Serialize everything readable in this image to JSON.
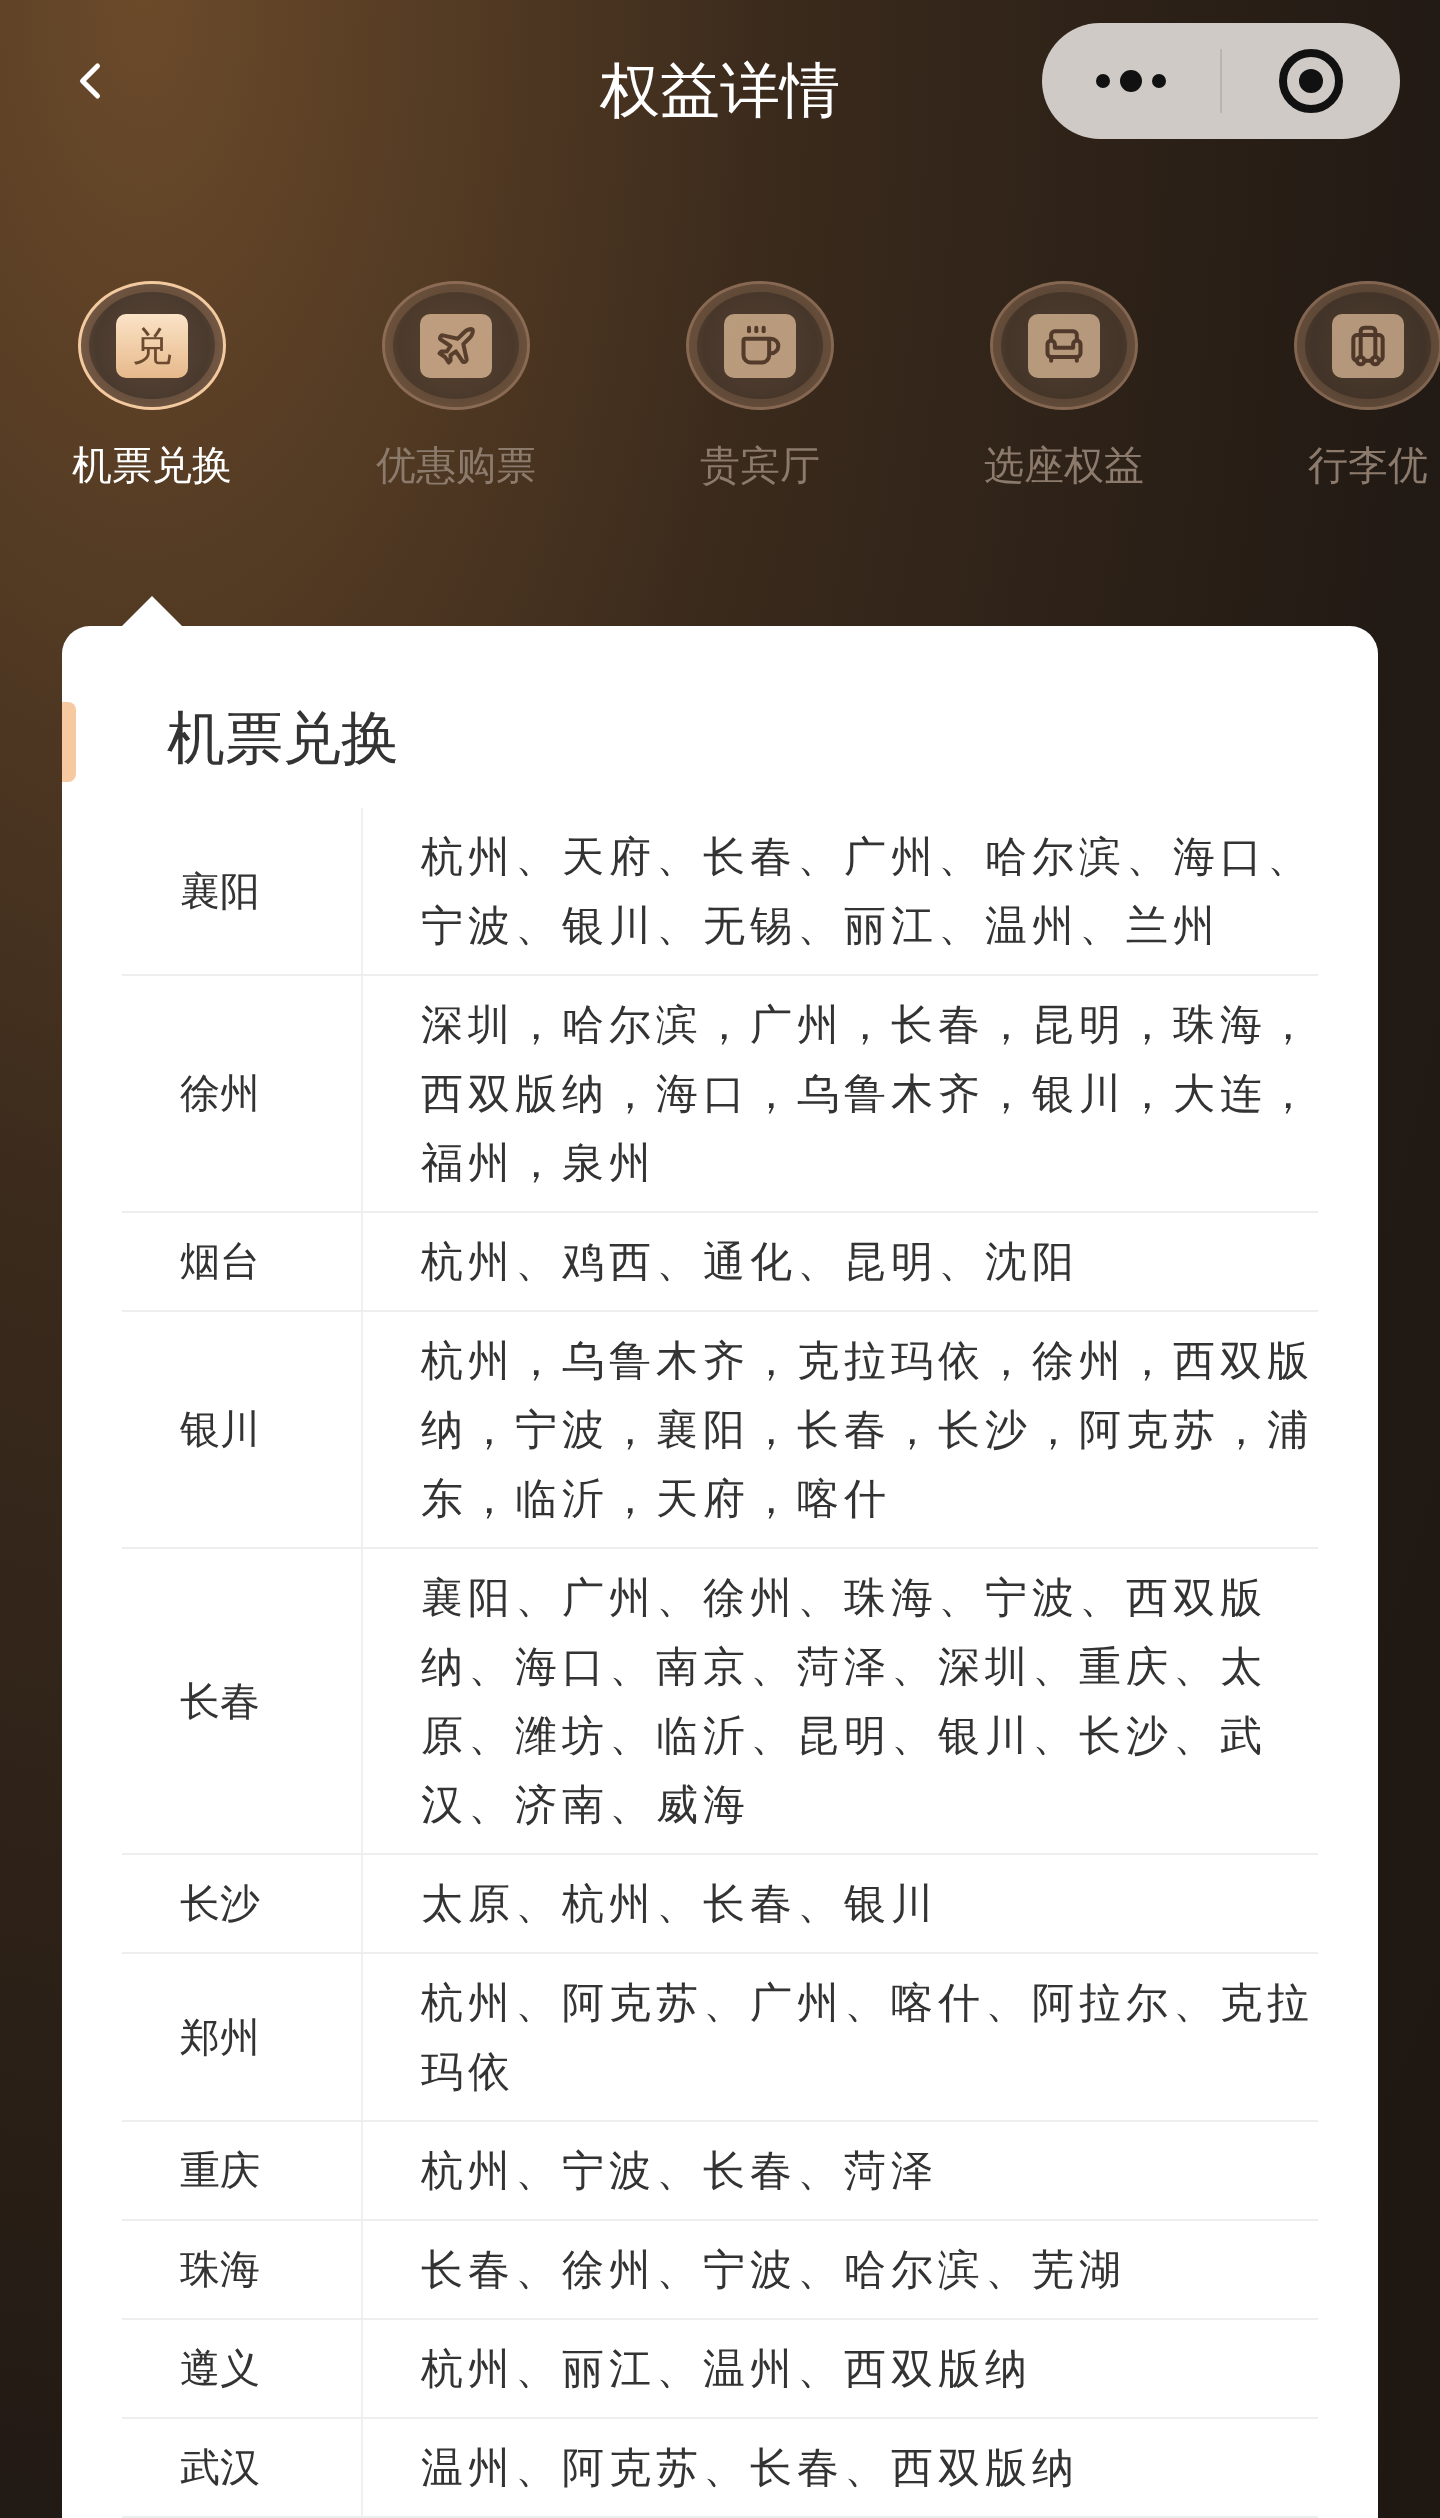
{
  "nav": {
    "title": "权益详情"
  },
  "tabs": [
    {
      "label": "机票兑换",
      "glyph": "兑",
      "selected": true
    },
    {
      "label": "优惠购票",
      "selected": false
    },
    {
      "label": "贵宾厅",
      "selected": false
    },
    {
      "label": "选座权益",
      "selected": false
    },
    {
      "label": "行李优",
      "selected": false
    }
  ],
  "card": {
    "title": "机票兑换",
    "rows": [
      {
        "city": "襄阳",
        "destinations": "杭州、天府、长春、广州、哈尔滨、海口、宁波、银川、无锡、丽江、温州、兰州"
      },
      {
        "city": "徐州",
        "destinations": "深圳，哈尔滨，广州，长春，昆明，珠海，西双版纳，海口，乌鲁木齐，银川，大连，福州，泉州"
      },
      {
        "city": "烟台",
        "destinations": "杭州、鸡西、通化、昆明、沈阳"
      },
      {
        "city": "银川",
        "destinations": "杭州，乌鲁木齐，克拉玛依，徐州，西双版纳，宁波，襄阳，长春，长沙，阿克苏，浦东，临沂，天府，喀什"
      },
      {
        "city": "长春",
        "destinations": "襄阳、广州、徐州、珠海、宁波、西双版纳、海口、南京、菏泽、深圳、重庆、太原、潍坊、临沂、昆明、银川、长沙、武汉、济南、威海"
      },
      {
        "city": "长沙",
        "destinations": "太原、杭州、长春、银川"
      },
      {
        "city": "郑州",
        "destinations": "杭州、阿克苏、广州、喀什、阿拉尔、克拉玛依"
      },
      {
        "city": "重庆",
        "destinations": "杭州、宁波、长春、菏泽"
      },
      {
        "city": "珠海",
        "destinations": "长春、徐州、宁波、哈尔滨、芜湖"
      },
      {
        "city": "遵义",
        "destinations": "杭州、丽江、温州、西双版纳"
      },
      {
        "city": "武汉",
        "destinations": "温州、阿克苏、长春、西双版纳"
      }
    ]
  }
}
